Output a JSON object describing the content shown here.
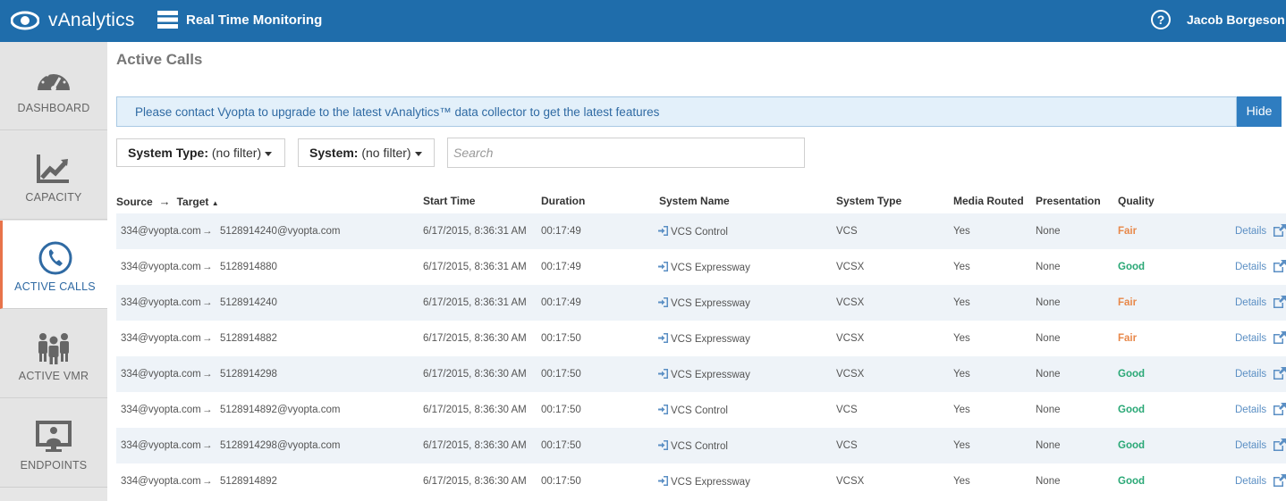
{
  "app": {
    "brand": "vAnalytics",
    "module": "Real Time Monitoring",
    "user": "Jacob Borgeson",
    "help_label": "?"
  },
  "colors": {
    "header": "#1f6dab",
    "accent_active": "#e8734a",
    "fair": "#e8884a",
    "good": "#2aa876",
    "link": "#5b8fc4"
  },
  "sidebar": {
    "items": [
      {
        "label": "DASHBOARD",
        "icon": "gauge-icon",
        "active": false
      },
      {
        "label": "CAPACITY",
        "icon": "trend-chart-icon",
        "active": false
      },
      {
        "label": "ACTIVE CALLS",
        "icon": "phone-icon",
        "active": true
      },
      {
        "label": "ACTIVE VMR",
        "icon": "group-icon",
        "active": false
      },
      {
        "label": "ENDPOINTS",
        "icon": "monitor-user-icon",
        "active": false
      }
    ]
  },
  "page": {
    "title": "Active Calls",
    "banner": "Please contact Vyopta to upgrade to the latest vAnalytics™ data collector to get the latest features",
    "hide_label": "Hide"
  },
  "filters": {
    "system_type": {
      "label": "System Type:",
      "value": "(no filter)"
    },
    "system": {
      "label": "System:",
      "value": "(no filter)"
    },
    "search_placeholder": "Search"
  },
  "table": {
    "headers": {
      "source": "Source",
      "target": "Target",
      "start_time": "Start Time",
      "duration": "Duration",
      "system_name": "System Name",
      "system_type": "System Type",
      "media_routed": "Media Routed",
      "presentation": "Presentation",
      "quality": "Quality"
    },
    "rows": [
      {
        "source": "334@vyopta.com",
        "target": "5128914240@vyopta.com",
        "start": "6/17/2015, 8:36:31 AM",
        "duration": "00:17:49",
        "system_name": "VCS Control",
        "system_type": "VCS",
        "media": "Yes",
        "presentation": "None",
        "quality": "Fair",
        "details": "Details"
      },
      {
        "source": "334@vyopta.com",
        "target": "5128914880",
        "start": "6/17/2015, 8:36:31 AM",
        "duration": "00:17:49",
        "system_name": "VCS Expressway",
        "system_type": "VCSX",
        "media": "Yes",
        "presentation": "None",
        "quality": "Good",
        "details": "Details"
      },
      {
        "source": "334@vyopta.com",
        "target": "5128914240",
        "start": "6/17/2015, 8:36:31 AM",
        "duration": "00:17:49",
        "system_name": "VCS Expressway",
        "system_type": "VCSX",
        "media": "Yes",
        "presentation": "None",
        "quality": "Fair",
        "details": "Details"
      },
      {
        "source": "334@vyopta.com",
        "target": "5128914882",
        "start": "6/17/2015, 8:36:30 AM",
        "duration": "00:17:50",
        "system_name": "VCS Expressway",
        "system_type": "VCSX",
        "media": "Yes",
        "presentation": "None",
        "quality": "Fair",
        "details": "Details"
      },
      {
        "source": "334@vyopta.com",
        "target": "5128914298",
        "start": "6/17/2015, 8:36:30 AM",
        "duration": "00:17:50",
        "system_name": "VCS Expressway",
        "system_type": "VCSX",
        "media": "Yes",
        "presentation": "None",
        "quality": "Good",
        "details": "Details"
      },
      {
        "source": "334@vyopta.com",
        "target": "5128914892@vyopta.com",
        "start": "6/17/2015, 8:36:30 AM",
        "duration": "00:17:50",
        "system_name": "VCS Control",
        "system_type": "VCS",
        "media": "Yes",
        "presentation": "None",
        "quality": "Good",
        "details": "Details"
      },
      {
        "source": "334@vyopta.com",
        "target": "5128914298@vyopta.com",
        "start": "6/17/2015, 8:36:30 AM",
        "duration": "00:17:50",
        "system_name": "VCS Control",
        "system_type": "VCS",
        "media": "Yes",
        "presentation": "None",
        "quality": "Good",
        "details": "Details"
      },
      {
        "source": "334@vyopta.com",
        "target": "5128914892",
        "start": "6/17/2015, 8:36:30 AM",
        "duration": "00:17:50",
        "system_name": "VCS Expressway",
        "system_type": "VCSX",
        "media": "Yes",
        "presentation": "None",
        "quality": "Good",
        "details": "Details"
      }
    ]
  }
}
